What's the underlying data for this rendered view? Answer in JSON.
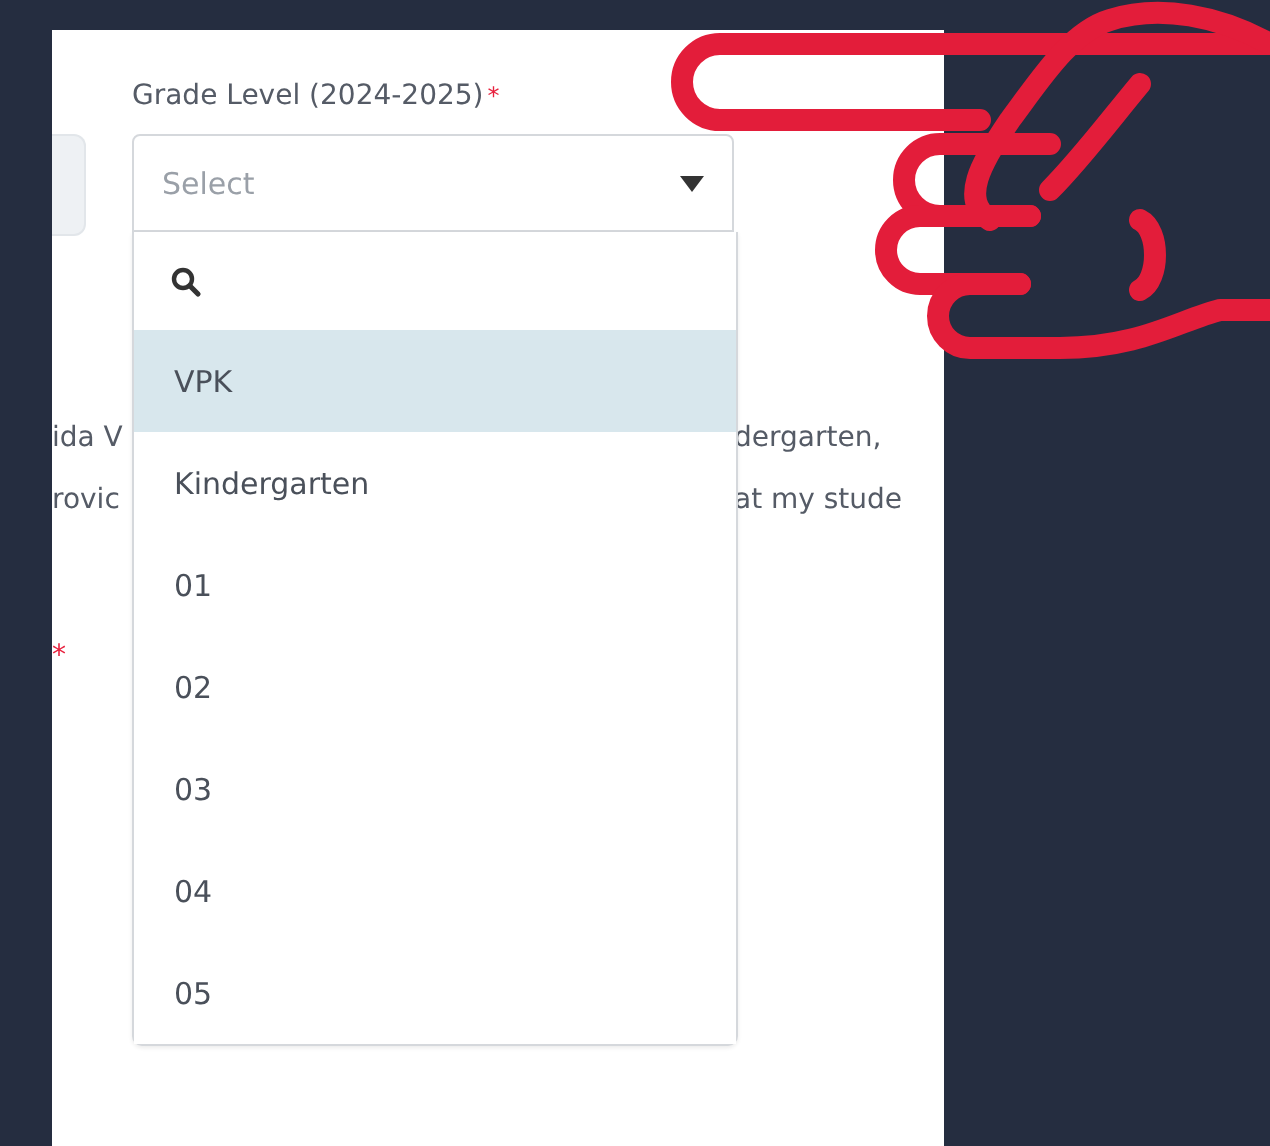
{
  "grade_field": {
    "label": "Grade Level (2024-2025)",
    "required_mark": "*",
    "placeholder": "Select",
    "expanded": true,
    "options": [
      {
        "label": "VPK",
        "selected": true
      },
      {
        "label": "Kindergarten",
        "selected": false
      },
      {
        "label": "01",
        "selected": false
      },
      {
        "label": "02",
        "selected": false
      },
      {
        "label": "03",
        "selected": false
      },
      {
        "label": "04",
        "selected": false
      },
      {
        "label": "05",
        "selected": false
      }
    ]
  },
  "paragraph": {
    "left_lines": [
      "ida V",
      "rovic"
    ],
    "right_lines": [
      "dergarten,",
      "at my stude"
    ]
  },
  "next_field": {
    "required_mark": "*"
  }
}
